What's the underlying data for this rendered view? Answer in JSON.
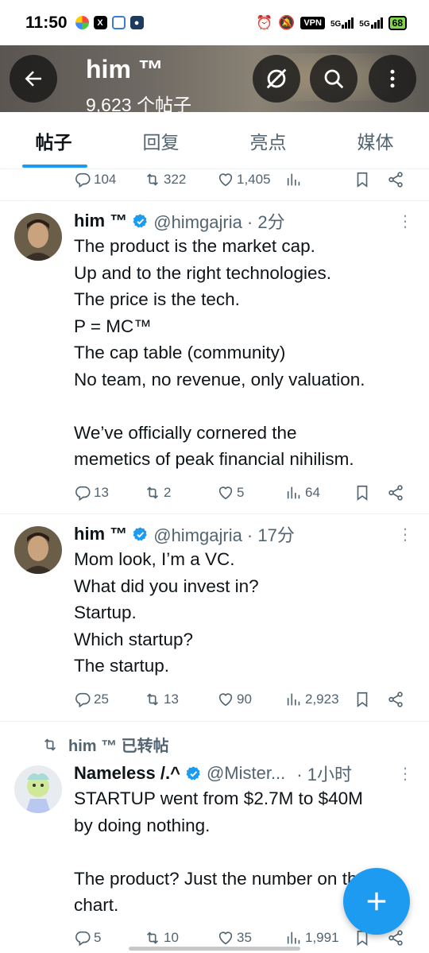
{
  "status_bar": {
    "time": "11:50",
    "vpn": "VPN",
    "net1": "5G",
    "net2": "5G",
    "battery": "68"
  },
  "header": {
    "title": "him ™",
    "subtitle": "9,623 个帖子"
  },
  "tabs": [
    {
      "label": "帖子",
      "active": true
    },
    {
      "label": "回复",
      "active": false
    },
    {
      "label": "亮点",
      "active": false
    },
    {
      "label": "媒体",
      "active": false
    }
  ],
  "top_actions": {
    "replies": "104",
    "reposts": "322",
    "likes": "1,405",
    "views": ""
  },
  "tweets": [
    {
      "name": "him ™",
      "handle": "@himgajria · 2分",
      "text": "The product is the market cap.\nUp and to the right technologies.\nThe price is the tech.\nP = MC™\nThe cap table (community)\nNo team, no revenue, only valuation.\n\nWe’ve officially cornered the\nmemetics of peak financial nihilism.",
      "replies": "13",
      "reposts": "2",
      "likes": "5",
      "views": "64"
    },
    {
      "name": "him ™",
      "handle": "@himgajria · 17分",
      "text": "Mom look, I’m a VC.\nWhat did you invest in?\nStartup.\nWhich startup?\nThe startup.",
      "replies": "25",
      "reposts": "13",
      "likes": "90",
      "views": "2,923"
    },
    {
      "repost_label": "him ™ 已转帖",
      "name": "Nameless /.^",
      "handle": "@Mister...",
      "time": "· 1小时",
      "text": "STARTUP went from $2.7M to $40M\nby doing nothing.\n\nThe product? Just the number on the\nchart.",
      "replies": "5",
      "reposts": "10",
      "likes": "35",
      "views": "1,991"
    }
  ],
  "colors": {
    "accent": "#1d9bf0",
    "muted": "#536471",
    "text": "#0f1419"
  }
}
